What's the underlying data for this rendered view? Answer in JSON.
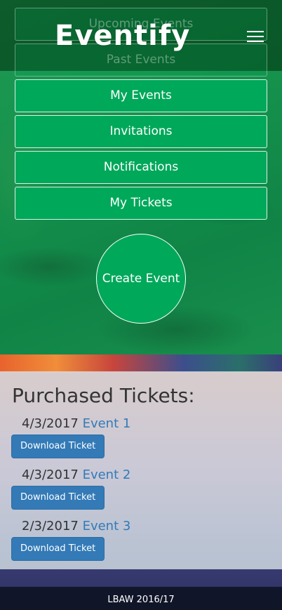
{
  "navbar": {
    "brand": "Eventify",
    "menu_icon": "hamburger-icon"
  },
  "menu": {
    "items": [
      {
        "label": "Upcoming Events"
      },
      {
        "label": "Past Events"
      },
      {
        "label": "My Events"
      },
      {
        "label": "Invitations"
      },
      {
        "label": "Notifications"
      },
      {
        "label": "My Tickets"
      }
    ]
  },
  "create_event": {
    "label": "Create Event"
  },
  "tickets": {
    "title": "Purchased Tickets:",
    "download_label": "Download Ticket",
    "items": [
      {
        "date": "4/3/2017",
        "event": "Event 1"
      },
      {
        "date": "4/3/2017",
        "event": "Event 2"
      },
      {
        "date": "2/3/2017",
        "event": "Event 3"
      }
    ]
  },
  "footer": {
    "text": "LBAW 2016/17"
  },
  "colors": {
    "accent_green": "#00a85a",
    "link_blue": "#337ab7",
    "button_blue": "#337ab7"
  }
}
